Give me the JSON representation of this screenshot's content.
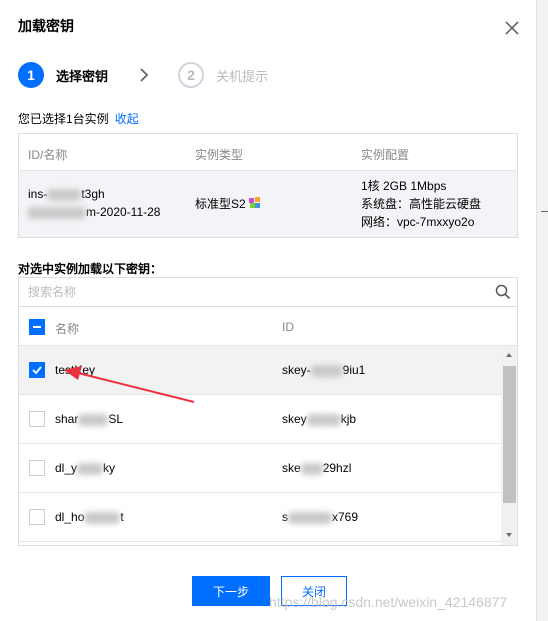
{
  "dialog": {
    "title": "加载密钥",
    "close_icon": "close-icon"
  },
  "steps": [
    {
      "number": "1",
      "label": "选择密钥",
      "state": "active"
    },
    {
      "number": "2",
      "label": "关机提示",
      "state": "inactive"
    }
  ],
  "selected_info": {
    "text": "您已选择1台实例",
    "collapse_link": "收起"
  },
  "instance_table": {
    "headers": [
      "ID/名称",
      "实例类型",
      "实例配置"
    ],
    "row": {
      "id": "ins-",
      "id_tail": "t3gh",
      "name_tail": "m-2020-11-28",
      "type": "标准型S2",
      "config": [
        "1核 2GB 1Mbps",
        "系统盘：高性能云硬盘",
        "网络：vpc-7mxxyo2o"
      ]
    }
  },
  "load_label": "对选中实例加载以下密钥：",
  "key_table": {
    "search_placeholder": "搜索名称",
    "headers": {
      "name": "名称",
      "id": "ID"
    },
    "rows": [
      {
        "name": "testKey",
        "id_prefix": "skey-",
        "id_suffix": "9iu1",
        "checked": true
      },
      {
        "name": "shar",
        "name_suffix": "SL",
        "id_prefix": "skey",
        "id_suffix": "kjb",
        "checked": false
      },
      {
        "name": "dl_y",
        "name_suffix": "ky",
        "id_prefix": "ske",
        "id_suffix": "29hzl",
        "checked": false
      },
      {
        "name": "dl_ho",
        "name_suffix": "t",
        "id_prefix": "s",
        "id_suffix": "x769",
        "checked": false
      }
    ]
  },
  "buttons": {
    "next": "下一步",
    "close": "关闭"
  },
  "watermark": "https://blog.csdn.net/weixin_42146877",
  "colors": {
    "primary": "#006eff",
    "annotation_arrow": "#e8323c",
    "row_selected": "#f2f2f2",
    "instance_row": "#f3f4f7"
  }
}
